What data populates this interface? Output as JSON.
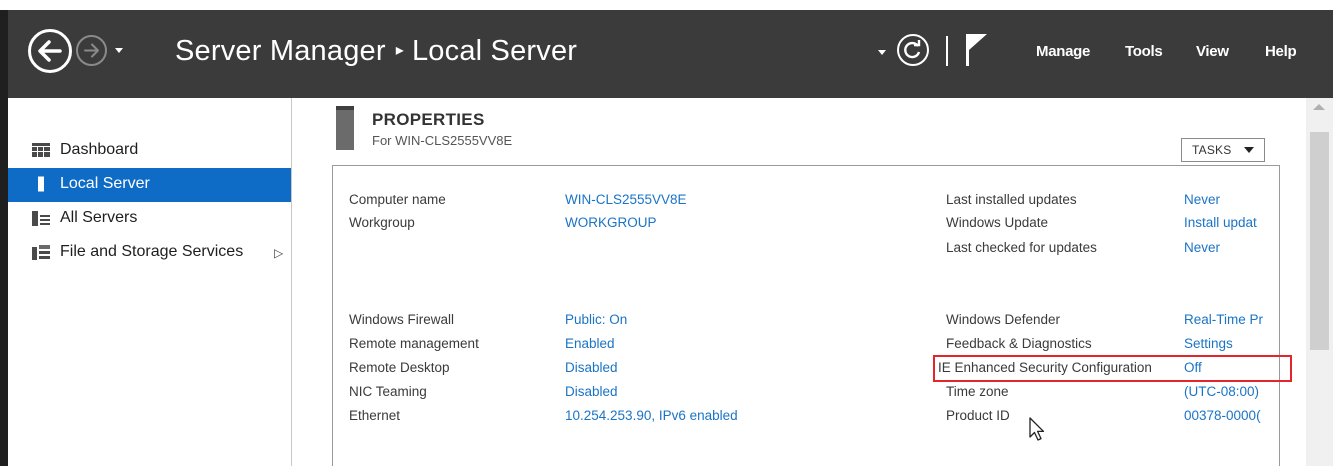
{
  "header": {
    "app_name": "Server Manager",
    "separator": "▸",
    "page_name": "Local Server",
    "menu": [
      "Manage",
      "Tools",
      "View",
      "Help"
    ]
  },
  "sidebar": {
    "items": [
      {
        "label": "Dashboard",
        "icon": "dashboard-icon",
        "active": false
      },
      {
        "label": "Local Server",
        "icon": "server-icon",
        "active": true
      },
      {
        "label": "All Servers",
        "icon": "servers-icon",
        "active": false
      },
      {
        "label": "File and Storage Services",
        "icon": "storage-icon",
        "active": false,
        "expandable": true
      }
    ]
  },
  "properties": {
    "title": "PROPERTIES",
    "subtitle": "For WIN-CLS2555VV8E",
    "tasks_label": "TASKS",
    "left_group_1": [
      {
        "label": "Computer name",
        "value": "WIN-CLS2555VV8E"
      },
      {
        "label": "Workgroup",
        "value": "WORKGROUP"
      }
    ],
    "left_group_2": [
      {
        "label": "Windows Firewall",
        "value": "Public: On"
      },
      {
        "label": "Remote management",
        "value": "Enabled"
      },
      {
        "label": "Remote Desktop",
        "value": "Disabled"
      },
      {
        "label": "NIC Teaming",
        "value": "Disabled"
      },
      {
        "label": "Ethernet",
        "value": "10.254.253.90, IPv6 enabled"
      }
    ],
    "right_group_1": [
      {
        "label": "Last installed updates",
        "value": "Never"
      },
      {
        "label": "Windows Update",
        "value": "Install updat"
      },
      {
        "label": "Last checked for updates",
        "value": "Never"
      }
    ],
    "right_group_2": [
      {
        "label": "Windows Defender",
        "value": "Real-Time Pr"
      },
      {
        "label": "Feedback & Diagnostics",
        "value": "Settings"
      },
      {
        "label": "IE Enhanced Security Configuration",
        "value": "Off"
      },
      {
        "label": "Time zone",
        "value": "(UTC-08:00)"
      },
      {
        "label": "Product ID",
        "value": "00378-0000("
      }
    ]
  },
  "colors": {
    "header_bg": "#3b3b3b",
    "active_item": "#0f6cc6",
    "link": "#1a74c6",
    "highlight": "#e4262c"
  }
}
